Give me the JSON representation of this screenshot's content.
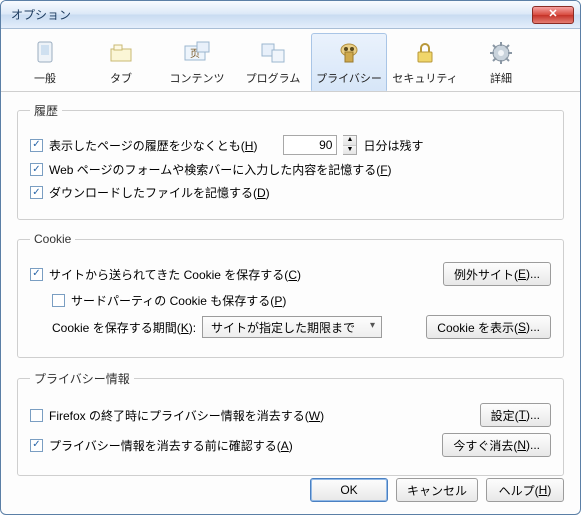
{
  "window": {
    "title": "オプション",
    "close": "✕"
  },
  "tabs": [
    {
      "label": "一般"
    },
    {
      "label": "タブ"
    },
    {
      "label": "コンテンツ"
    },
    {
      "label": "プログラム"
    },
    {
      "label": "プライバシー"
    },
    {
      "label": "セキュリティ"
    },
    {
      "label": "詳細"
    }
  ],
  "history": {
    "legend": "履歴",
    "row1a": "表示したページの履歴を少なくとも(",
    "row1key": "H",
    "row1b": ")",
    "days_value": "90",
    "row1c": "日分は残す",
    "row2a": "Web ページのフォームや検索バーに入力した内容を記憶する(",
    "row2key": "F",
    "row2b": ")",
    "row3a": "ダウンロードしたファイルを記憶する(",
    "row3key": "D",
    "row3b": ")"
  },
  "cookie": {
    "legend": "Cookie",
    "row1a": "サイトから送られてきた Cookie を保存する(",
    "row1key": "C",
    "row1b": ")",
    "exceptions_a": "例外サイト(",
    "exceptions_key": "E",
    "exceptions_b": ")...",
    "row2a": "サードパーティの Cookie も保存する(",
    "row2key": "P",
    "row2b": ")",
    "keep_label_a": "Cookie を保存する期間(",
    "keep_key": "K",
    "keep_label_b": "):",
    "keep_value": "サイトが指定した期限まで",
    "show_a": "Cookie を表示(",
    "show_key": "S",
    "show_b": ")..."
  },
  "privacy": {
    "legend": "プライバシー情報",
    "row1a": "Firefox の終了時にプライバシー情報を消去する(",
    "row1key": "W",
    "row1b": ")",
    "settings_a": "設定(",
    "settings_key": "T",
    "settings_b": ")...",
    "row2a": "プライバシー情報を消去する前に確認する(",
    "row2key": "A",
    "row2b": ")",
    "clear_a": "今すぐ消去(",
    "clear_key": "N",
    "clear_b": ")..."
  },
  "buttons": {
    "ok": "OK",
    "cancel": "キャンセル",
    "help_a": "ヘルプ(",
    "help_key": "H",
    "help_b": ")"
  }
}
